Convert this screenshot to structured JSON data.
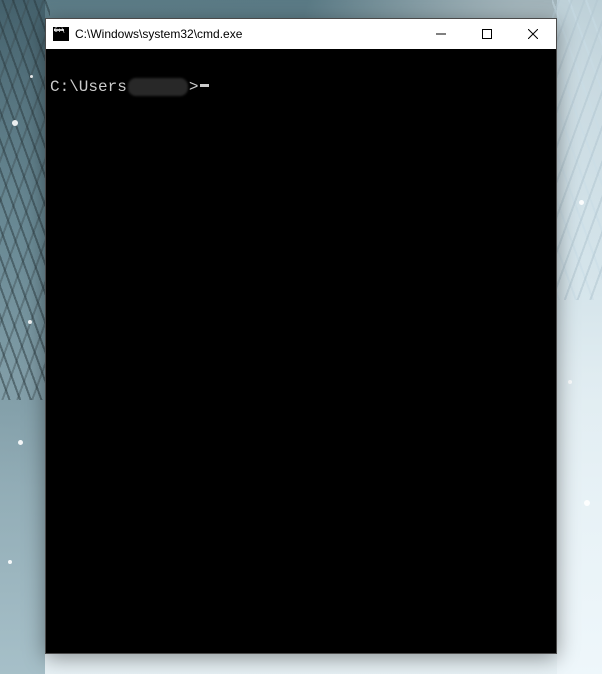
{
  "window": {
    "title": "C:\\Windows\\system32\\cmd.exe",
    "icon": "cmd-icon"
  },
  "terminal": {
    "prompt_prefix": "C:\\Users",
    "prompt_suffix": ">",
    "input": ""
  }
}
